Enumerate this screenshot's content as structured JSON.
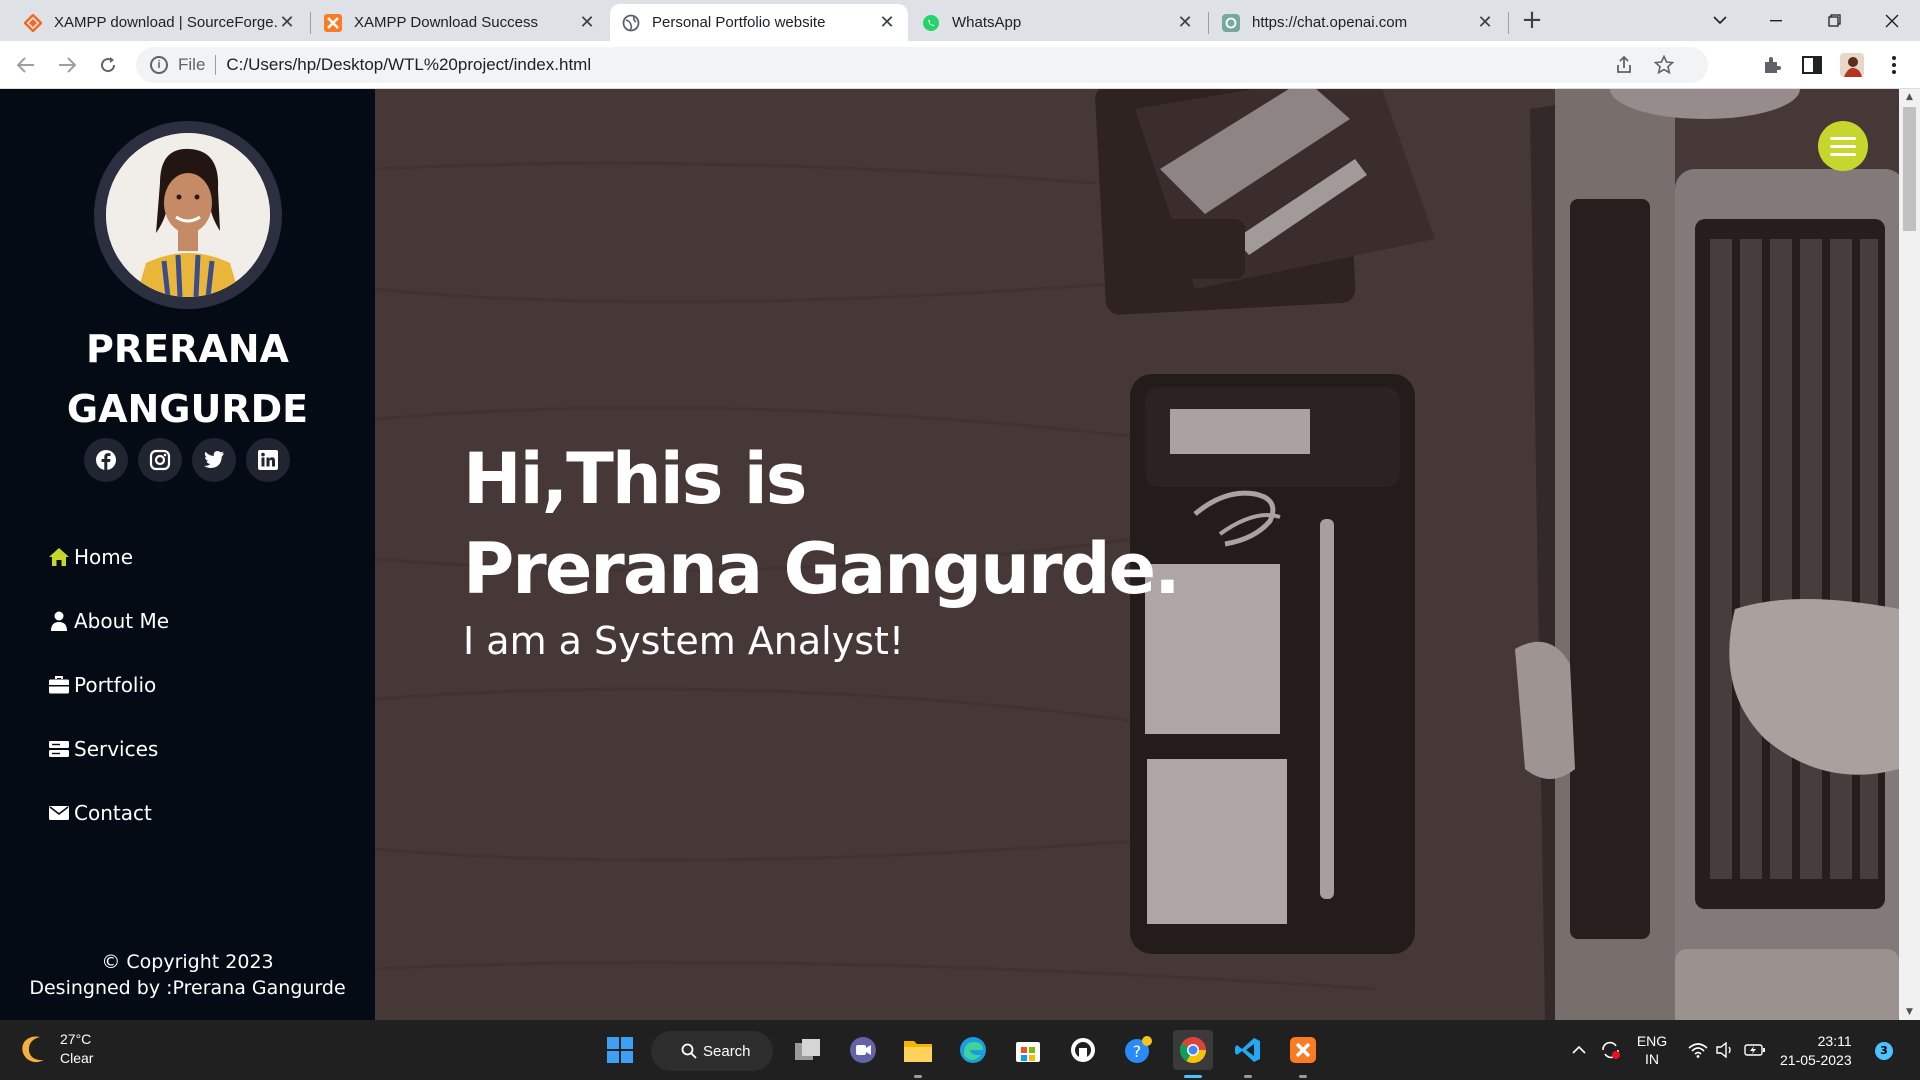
{
  "browser": {
    "tabs": [
      {
        "title": "XAMPP download | SourceForge.net",
        "favicon": "xampp-diamond-icon",
        "active": false
      },
      {
        "title": "XAMPP Download Success",
        "favicon": "xampp-icon",
        "active": false
      },
      {
        "title": "Personal Portfolio website",
        "favicon": "globe-icon",
        "active": true
      },
      {
        "title": "WhatsApp",
        "favicon": "whatsapp-icon",
        "active": false
      },
      {
        "title": "https://chat.openai.com",
        "favicon": "openai-icon",
        "active": false
      }
    ],
    "address": {
      "scheme": "File",
      "url": "C:/Users/hp/Desktop/WTL%20project/index.html"
    }
  },
  "page": {
    "sidebar": {
      "name": "PRERANA GANGURDE",
      "socials": [
        "facebook-icon",
        "instagram-icon",
        "twitter-icon",
        "linkedin-icon"
      ],
      "nav": [
        {
          "label": "Home",
          "icon": "home-icon",
          "active": true
        },
        {
          "label": "About Me",
          "icon": "user-icon",
          "active": false
        },
        {
          "label": "Portfolio",
          "icon": "briefcase-icon",
          "active": false
        },
        {
          "label": "Services",
          "icon": "server-icon",
          "active": false
        },
        {
          "label": "Contact",
          "icon": "envelope-icon",
          "active": false
        }
      ],
      "footer": {
        "copyright": "© Copyright 2023",
        "designed_by": "Desingned by :Prerana Gangurde"
      },
      "accent": "#c6d62c",
      "background": "#040b14"
    },
    "hero": {
      "title_line1": "Hi,This is",
      "title_line2": "Prerana Gangurde.",
      "subtitle": "I am a System Analyst!"
    }
  },
  "taskbar": {
    "weather": {
      "temp": "27°C",
      "condition": "Clear"
    },
    "search_label": "Search",
    "language": {
      "line1": "ENG",
      "line2": "IN"
    },
    "clock": {
      "time": "23:11",
      "date": "21-05-2023"
    },
    "notifications": "3"
  }
}
